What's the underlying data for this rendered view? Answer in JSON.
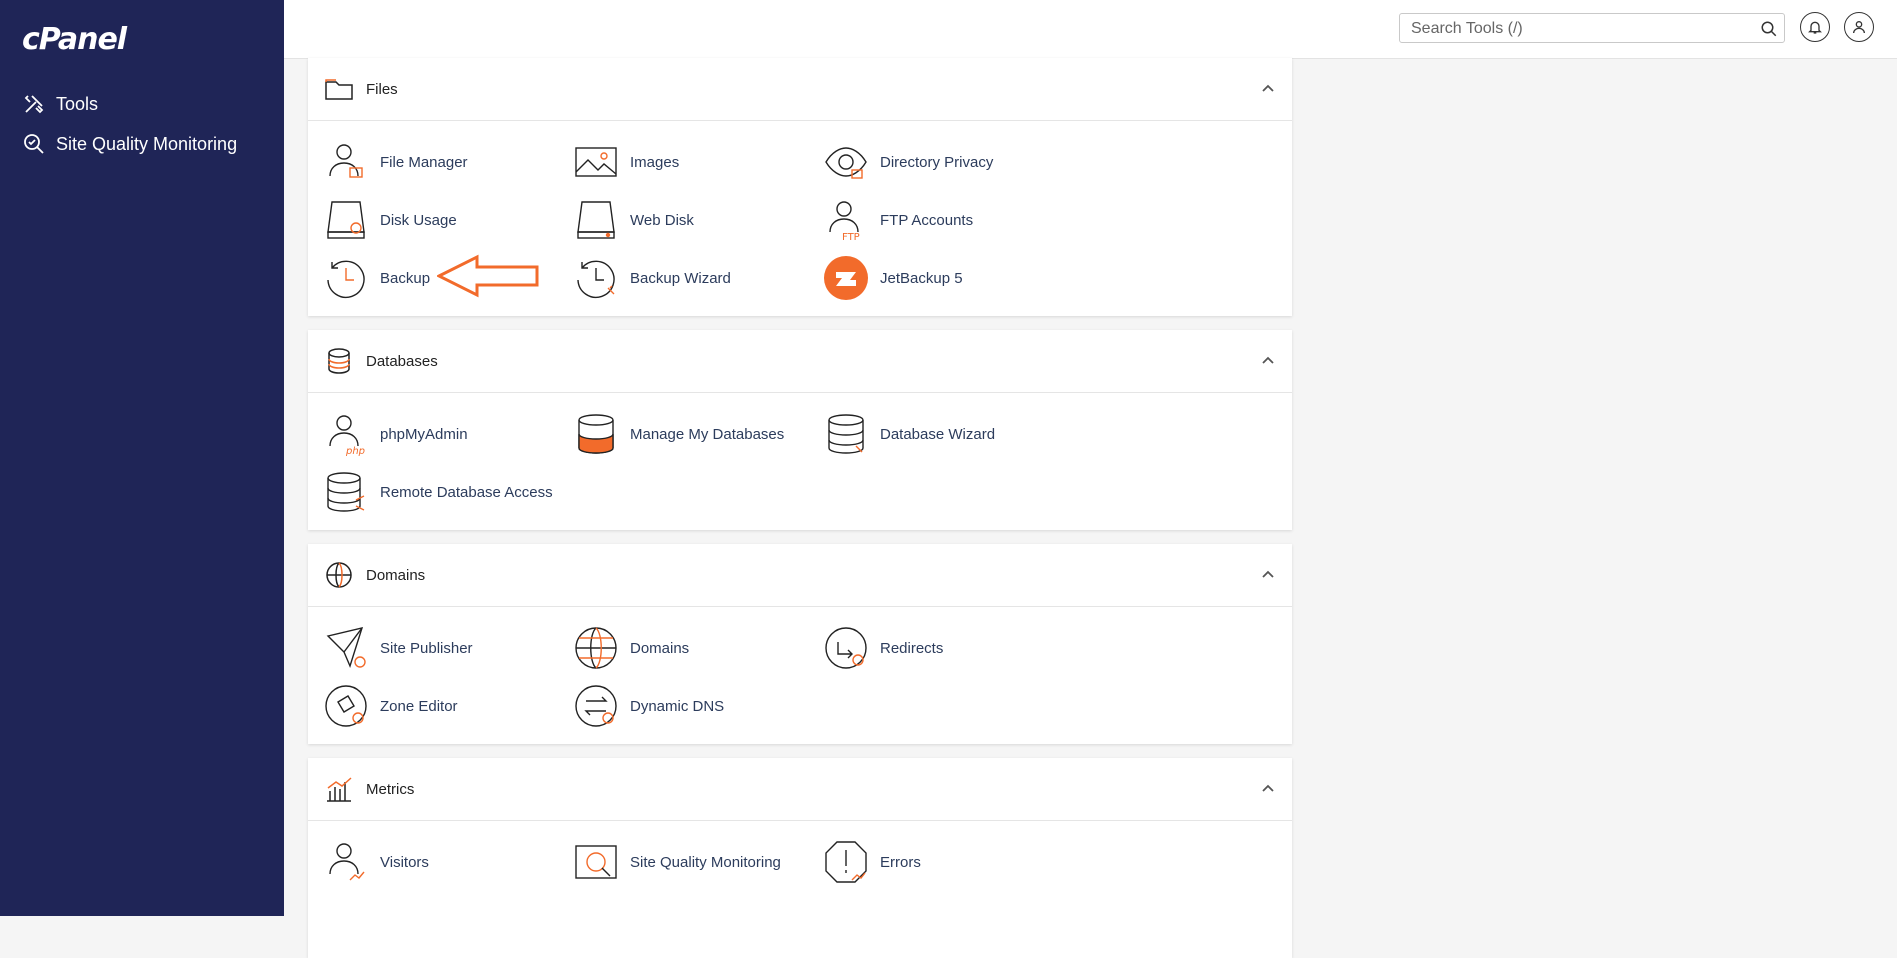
{
  "sidebar": {
    "logo": "cPanel",
    "items": [
      {
        "label": "Tools",
        "icon": "tools-icon"
      },
      {
        "label": "Site Quality Monitoring",
        "icon": "site-quality-icon"
      }
    ]
  },
  "header": {
    "search_placeholder": "Search Tools (/)"
  },
  "colors": {
    "sidebar_bg": "#1f2557",
    "accent": "#f26b2b",
    "link": "#2c3c5c"
  },
  "sections": [
    {
      "title": "Files",
      "items": [
        "File Manager",
        "Images",
        "Directory Privacy",
        "Disk Usage",
        "Web Disk",
        "FTP Accounts",
        "Backup",
        "Backup Wizard",
        "JetBackup 5"
      ]
    },
    {
      "title": "Databases",
      "items": [
        "phpMyAdmin",
        "Manage My Databases",
        "Database Wizard",
        "Remote Database Access"
      ]
    },
    {
      "title": "Domains",
      "items": [
        "Site Publisher",
        "Domains",
        "Redirects",
        "Zone Editor",
        "Dynamic DNS"
      ]
    },
    {
      "title": "Metrics",
      "items": [
        "Visitors",
        "Site Quality Monitoring",
        "Errors"
      ]
    }
  ]
}
